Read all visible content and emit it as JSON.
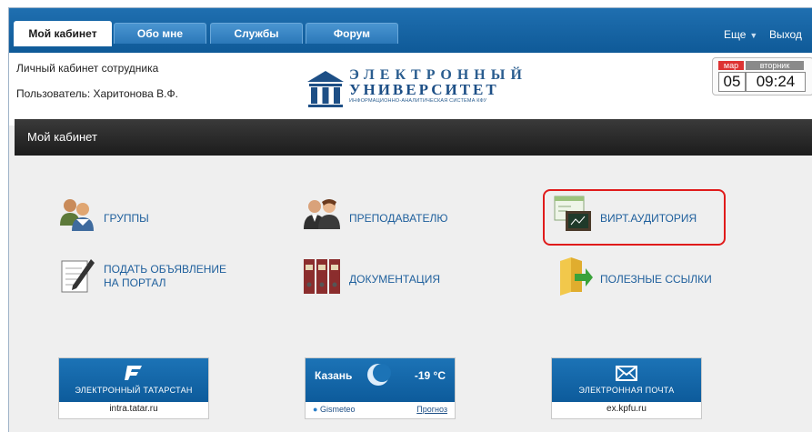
{
  "nav": {
    "tabs": [
      {
        "label": "Мой кабинет",
        "active": true
      },
      {
        "label": "Обо мне",
        "active": false
      },
      {
        "label": "Службы",
        "active": false
      },
      {
        "label": "Форум",
        "active": false
      }
    ],
    "more_label": "Еще",
    "logout_label": "Выход"
  },
  "header": {
    "line1": "Личный кабинет сотрудника",
    "line2": "Пользователь: Харитонова В.Ф."
  },
  "logo": {
    "line1": "ЭЛЕКТРОННЫЙ",
    "line2": "УНИВЕРСИТЕТ",
    "line3": "ИНФОРМАЦИОННО-АНАЛИТИЧЕСКАЯ СИСТЕМА КФУ"
  },
  "clock": {
    "month": "мар",
    "weekday": "вторник",
    "day": "05",
    "time": "09:24"
  },
  "section_title": "Мой кабинет",
  "menu": {
    "groups": {
      "label": "ГРУППЫ"
    },
    "teacher": {
      "label": "ПРЕПОДАВАТЕЛЮ"
    },
    "virtual": {
      "label": "ВИРТ.АУДИТОРИЯ"
    },
    "announce": {
      "line1": "ПОДАТЬ ОБЪЯВЛЕНИЕ",
      "line2": "НА ПОРТАЛ"
    },
    "docs": {
      "label": "ДОКУМЕНТАЦИЯ"
    },
    "links": {
      "label": "ПОЛЕЗНЫЕ ССЫЛКИ"
    }
  },
  "widgets": {
    "tatar": {
      "title": "ЭЛЕКТРОННЫЙ ТАТАРСТАН",
      "link": "intra.tatar.ru"
    },
    "weather": {
      "city": "Казань",
      "temp": "-19 °C",
      "brand": "Gismeteo",
      "forecast": "Прогноз"
    },
    "mail": {
      "title": "ЭЛЕКТРОННАЯ ПОЧТА",
      "link": "ex.kpfu.ru"
    }
  },
  "colors": {
    "nav_blue": "#1566a8",
    "link_blue": "#1e5f9c",
    "highlight_red": "#e01b1b",
    "section_bar": "#262626"
  }
}
